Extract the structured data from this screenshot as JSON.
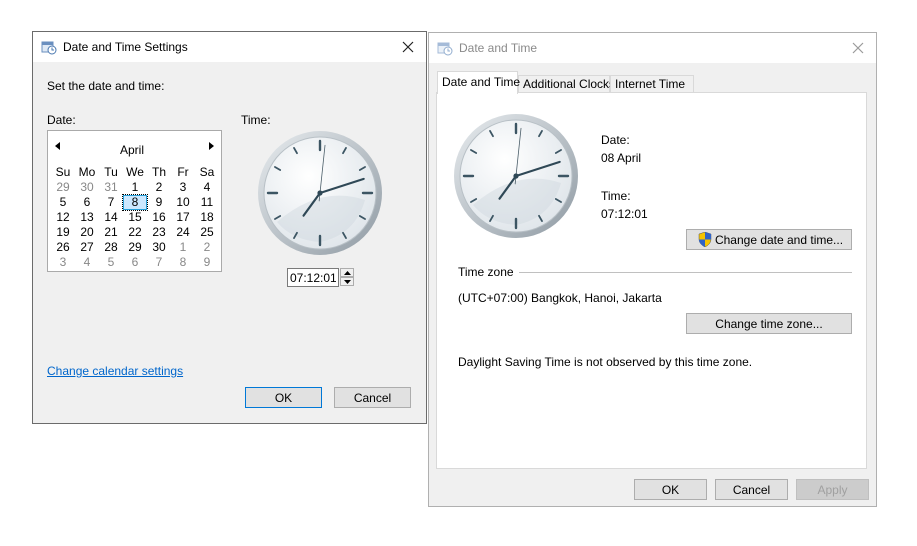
{
  "settings_dialog": {
    "title": "Date and Time Settings",
    "instruction": "Set the date and time:",
    "date_label": "Date:",
    "time_label": "Time:",
    "calendar": {
      "month": "April",
      "weekdays": [
        "Su",
        "Mo",
        "Tu",
        "We",
        "Th",
        "Fr",
        "Sa"
      ],
      "weeks": [
        [
          "29",
          "30",
          "31",
          "1",
          "2",
          "3",
          "4"
        ],
        [
          "5",
          "6",
          "7",
          "8",
          "9",
          "10",
          "11"
        ],
        [
          "12",
          "13",
          "14",
          "15",
          "16",
          "17",
          "18"
        ],
        [
          "19",
          "20",
          "21",
          "22",
          "23",
          "24",
          "25"
        ],
        [
          "26",
          "27",
          "28",
          "29",
          "30",
          "1",
          "2"
        ],
        [
          "3",
          "4",
          "5",
          "6",
          "7",
          "8",
          "9"
        ]
      ],
      "selected_day": "8"
    },
    "time_value": "07:12:01",
    "clock": {
      "hour": 7,
      "minute": 12,
      "second": 1
    },
    "change_calendar_link": "Change calendar settings",
    "ok_label": "OK",
    "cancel_label": "Cancel"
  },
  "main_dialog": {
    "title": "Date and Time",
    "tabs": [
      "Date and Time",
      "Additional Clocks",
      "Internet Time"
    ],
    "date_label": "Date:",
    "date_value": "08 April",
    "time_label": "Time:",
    "time_value": "07:12:01",
    "change_datetime_button": "Change date and time...",
    "timezone_header": "Time zone",
    "timezone_value": "(UTC+07:00) Bangkok, Hanoi, Jakarta",
    "change_timezone_button": "Change time zone...",
    "dst_text": "Daylight Saving Time is not observed by this time zone.",
    "ok_label": "OK",
    "cancel_label": "Cancel",
    "apply_label": "Apply"
  },
  "colors": {
    "accent": "#0078d7",
    "link": "#0066cc",
    "window_bg": "#f0f0f0"
  }
}
